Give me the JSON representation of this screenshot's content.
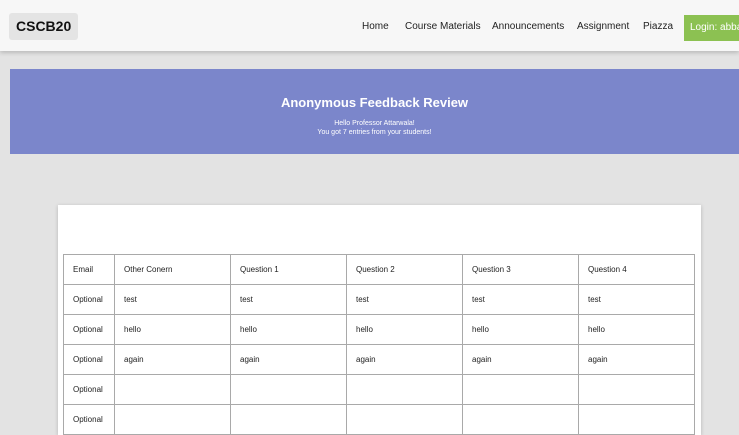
{
  "navbar": {
    "brand": "CSCB20",
    "links": [
      "Home",
      "Course Materials",
      "Announcements",
      "Assignment",
      "Piazza"
    ],
    "login_label": "Login: abbas"
  },
  "banner": {
    "title": "Anonymous Feedback Review",
    "greeting": "Hello Professor Attarwala!",
    "summary": "You got 7 entries from your students!",
    "color": "#7b86cb"
  },
  "table": {
    "headers": [
      "Email",
      "Other Conern",
      "Question 1",
      "Question 2",
      "Question 3",
      "Question 4"
    ],
    "rows": [
      [
        "Optional",
        "test",
        "test",
        "test",
        "test",
        "test"
      ],
      [
        "Optional",
        "hello",
        "hello",
        "hello",
        "hello",
        "hello"
      ],
      [
        "Optional",
        "again",
        "again",
        "again",
        "again",
        "again"
      ],
      [
        "Optional",
        "",
        "",
        "",
        "",
        ""
      ],
      [
        "Optional",
        "",
        "",
        "",
        "",
        ""
      ]
    ]
  },
  "colors": {
    "login_button": "#8cc152",
    "page_background": "#e3e3e3",
    "navbar_background": "#f7f7f7"
  }
}
